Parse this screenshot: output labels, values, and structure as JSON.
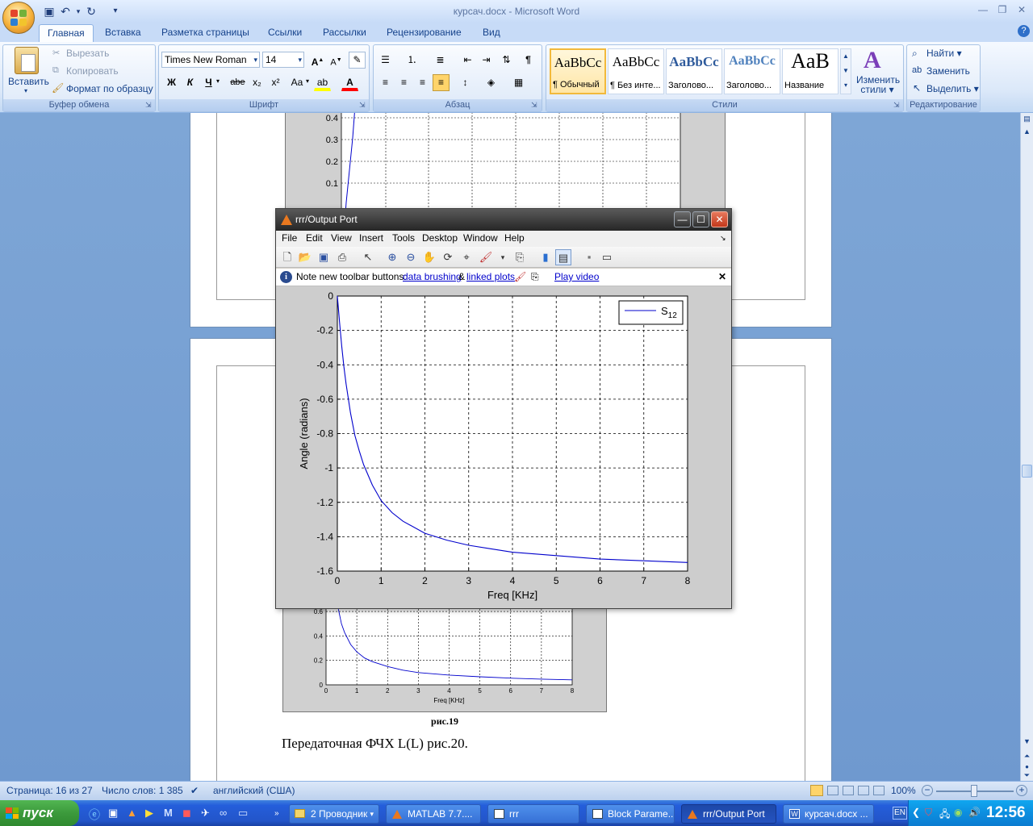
{
  "word": {
    "title": "курсач.docx - Microsoft Word",
    "tabs": [
      "Главная",
      "Вставка",
      "Разметка страницы",
      "Ссылки",
      "Рассылки",
      "Рецензирование",
      "Вид"
    ],
    "clipboard": {
      "paste": "Вставить",
      "cut": "Вырезать",
      "copy": "Копировать",
      "format_painter": "Формат по образцу",
      "label": "Буфер обмена"
    },
    "font": {
      "name": "Times New Roman",
      "size": "14",
      "label": "Шрифт",
      "bold": "Ж",
      "italic": "К",
      "underline": "Ч",
      "strike": "abe",
      "sub": "x₂",
      "sup": "x²",
      "case": "Aa"
    },
    "paragraph": {
      "label": "Абзац"
    },
    "styles": {
      "label": "Стили",
      "items": [
        {
          "preview": "AaBbCc",
          "name": "¶ Обычный"
        },
        {
          "preview": "AaBbCc",
          "name": "¶ Без инте..."
        },
        {
          "preview": "AaBbCc",
          "name": "Заголово..."
        },
        {
          "preview": "AaBbCc",
          "name": "Заголово..."
        },
        {
          "preview": "AaB",
          "name": "Название"
        }
      ],
      "change_line1": "Изменить",
      "change_line2": "стили"
    },
    "editing": {
      "find": "Найти",
      "replace": "Заменить",
      "select": "Выделить",
      "label": "Редактирование"
    },
    "doc": {
      "caption": "рис.19",
      "paragraph": "Передаточная ФЧХ L(L) рис.20."
    },
    "status": {
      "page": "Страница: 16 из 27",
      "words": "Число слов: 1 385",
      "lang": "английский (США)",
      "zoom": "100%"
    }
  },
  "matlab": {
    "window_title": "rrr/Output Port",
    "menu": [
      "File",
      "Edit",
      "View",
      "Insert",
      "Tools",
      "Desktop",
      "Window",
      "Help"
    ],
    "info": {
      "prefix": "Note new toolbar buttons:",
      "link1": "data brushing",
      "amp": "&",
      "link2": "linked plots",
      "link3": "Play video"
    }
  },
  "chart_data": [
    {
      "type": "line",
      "xlabel": "Freq [KHz]",
      "ylabel": "Angle (radians)",
      "xlim": [
        0,
        8
      ],
      "ylim": [
        -1.6,
        0
      ],
      "xticks": [
        "0",
        "1",
        "2",
        "3",
        "4",
        "5",
        "6",
        "7",
        "8"
      ],
      "yticks": [
        "0",
        "-0.2",
        "-0.4",
        "-0.6",
        "-0.8",
        "-1",
        "-1.2",
        "-1.4",
        "-1.6"
      ],
      "grid": true,
      "legend_position": "top-right",
      "series": [
        {
          "name": "S12",
          "color": "#0000cc",
          "x": [
            0.02,
            0.05,
            0.1,
            0.15,
            0.2,
            0.3,
            0.4,
            0.5,
            0.6,
            0.8,
            1,
            1.25,
            1.5,
            2,
            2.5,
            3,
            3.5,
            4,
            5,
            6,
            7,
            8
          ],
          "y": [
            -0.06,
            -0.15,
            -0.29,
            -0.41,
            -0.51,
            -0.68,
            -0.81,
            -0.9,
            -0.98,
            -1.1,
            -1.19,
            -1.26,
            -1.31,
            -1.38,
            -1.42,
            -1.45,
            -1.47,
            -1.49,
            -1.51,
            -1.53,
            -1.54,
            -1.55
          ]
        }
      ]
    },
    {
      "type": "line",
      "xlabel": "Freq [KHz]",
      "xlim": [
        0,
        8
      ],
      "xticks": [
        "0",
        "1",
        "2",
        "3",
        "4",
        "5",
        "6",
        "7",
        "8"
      ],
      "yticks": [
        "0",
        "0.2",
        "0.4",
        "0.6"
      ],
      "grid": true,
      "series": [
        {
          "color": "#0000cc",
          "x": [
            0.4,
            0.5,
            0.6,
            0.8,
            1,
            1.25,
            1.5,
            2,
            2.5,
            3,
            4,
            5,
            6,
            7,
            8
          ],
          "y": [
            0.62,
            0.5,
            0.43,
            0.33,
            0.27,
            0.22,
            0.19,
            0.15,
            0.12,
            0.1,
            0.08,
            0.066,
            0.055,
            0.047,
            0.041
          ]
        }
      ]
    },
    {
      "type": "line",
      "yticks": [
        "0.4",
        "0.3",
        "0.2",
        "0.1"
      ],
      "grid": true,
      "series": [
        {
          "color": "#0000cc"
        }
      ]
    }
  ],
  "taskbar": {
    "start": "пуск",
    "tasks": [
      "2 Проводник",
      "MATLAB 7.7....",
      "rrr",
      "Block Parame...",
      "rrr/Output Port",
      "курсач.docx ..."
    ],
    "lang": "EN",
    "clock": "12:56"
  }
}
